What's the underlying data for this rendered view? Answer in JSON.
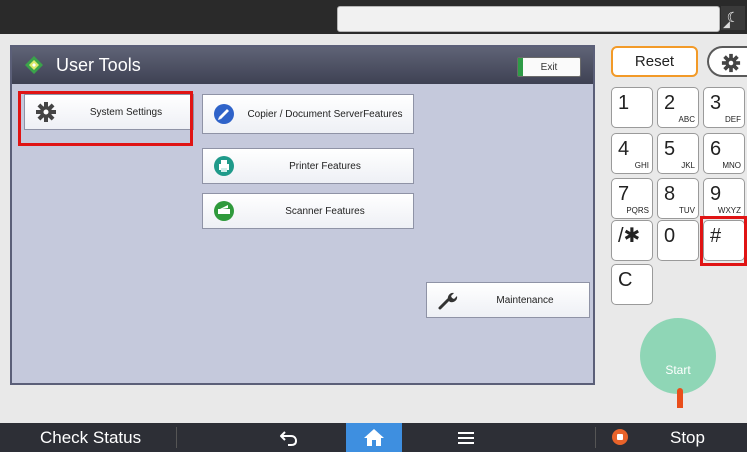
{
  "header": {
    "title": "User Tools",
    "exit_label": "Exit"
  },
  "menu": {
    "system_settings": "System Settings",
    "copier_document_server_line1": "Copier / Document Server",
    "copier_document_server_line2": "Features",
    "printer_features": "Printer Features",
    "scanner_features": "Scanner Features",
    "maintenance": "Maintenance"
  },
  "keypad": {
    "reset_label": "Reset",
    "keys": [
      {
        "digit": "1",
        "sub": ""
      },
      {
        "digit": "2",
        "sub": "ABC"
      },
      {
        "digit": "3",
        "sub": "DEF"
      },
      {
        "digit": "4",
        "sub": "GHI"
      },
      {
        "digit": "5",
        "sub": "JKL"
      },
      {
        "digit": "6",
        "sub": "MNO"
      },
      {
        "digit": "7",
        "sub": "PQRS"
      },
      {
        "digit": "8",
        "sub": "TUV"
      },
      {
        "digit": "9",
        "sub": "WXYZ"
      },
      {
        "digit": "/✱",
        "sub": ""
      },
      {
        "digit": "0",
        "sub": ""
      },
      {
        "digit": "#",
        "sub": ""
      },
      {
        "digit": "C",
        "sub": ""
      }
    ],
    "start_label": "Start"
  },
  "bottom_bar": {
    "check_status": "Check Status",
    "stop": "Stop"
  },
  "colors": {
    "highlight": "#e01414",
    "reset_border": "#f29a28",
    "start": "#8fd6b6",
    "home": "#3e8fe0",
    "panel_bg": "#c5c9dc"
  }
}
